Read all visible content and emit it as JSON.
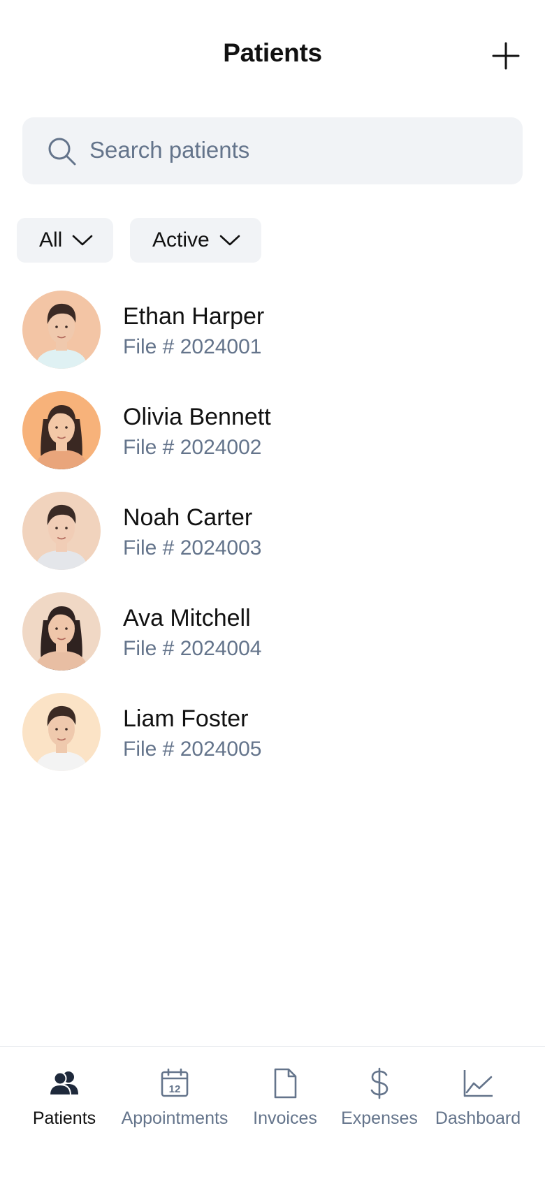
{
  "header": {
    "title": "Patients"
  },
  "search": {
    "placeholder": "Search patients"
  },
  "filters": [
    {
      "label": "All"
    },
    {
      "label": "Active"
    }
  ],
  "patients": [
    {
      "name": "Ethan Harper",
      "file": "File # 2024001",
      "avatar_bg": "#f3c5a5",
      "skin": "#f0c9ad",
      "hair": "#3b2a24",
      "shirt": "#dff1f3"
    },
    {
      "name": "Olivia Bennett",
      "file": "File # 2024002",
      "avatar_bg": "#f7b27a",
      "skin": "#f3c8a7",
      "hair": "#3a2822",
      "shirt": "#e9a57b"
    },
    {
      "name": "Noah Carter",
      "file": "File # 2024003",
      "avatar_bg": "#f1d3bd",
      "skin": "#f1cdb6",
      "hair": "#3a2a25",
      "shirt": "#e4e6ea"
    },
    {
      "name": "Ava Mitchell",
      "file": "File # 2024004",
      "avatar_bg": "#f0d8c5",
      "skin": "#efc6aa",
      "hair": "#2f2220",
      "shirt": "#e8bea3"
    },
    {
      "name": "Liam Foster",
      "file": "File # 2024005",
      "avatar_bg": "#fbe3c6",
      "skin": "#efc9ad",
      "hair": "#3c2b24",
      "shirt": "#f3f3f3"
    }
  ],
  "tabs": [
    {
      "label": "Patients",
      "icon": "people-icon",
      "active": true
    },
    {
      "label": "Appointments",
      "icon": "calendar-icon",
      "calendar_day": "12",
      "active": false
    },
    {
      "label": "Invoices",
      "icon": "document-icon",
      "active": false
    },
    {
      "label": "Expenses",
      "icon": "dollar-icon",
      "active": false
    },
    {
      "label": "Dashboard",
      "icon": "chart-line-icon",
      "active": false
    }
  ],
  "colors": {
    "text": "#111111",
    "muted": "#64748b",
    "surface": "#f1f3f6"
  }
}
